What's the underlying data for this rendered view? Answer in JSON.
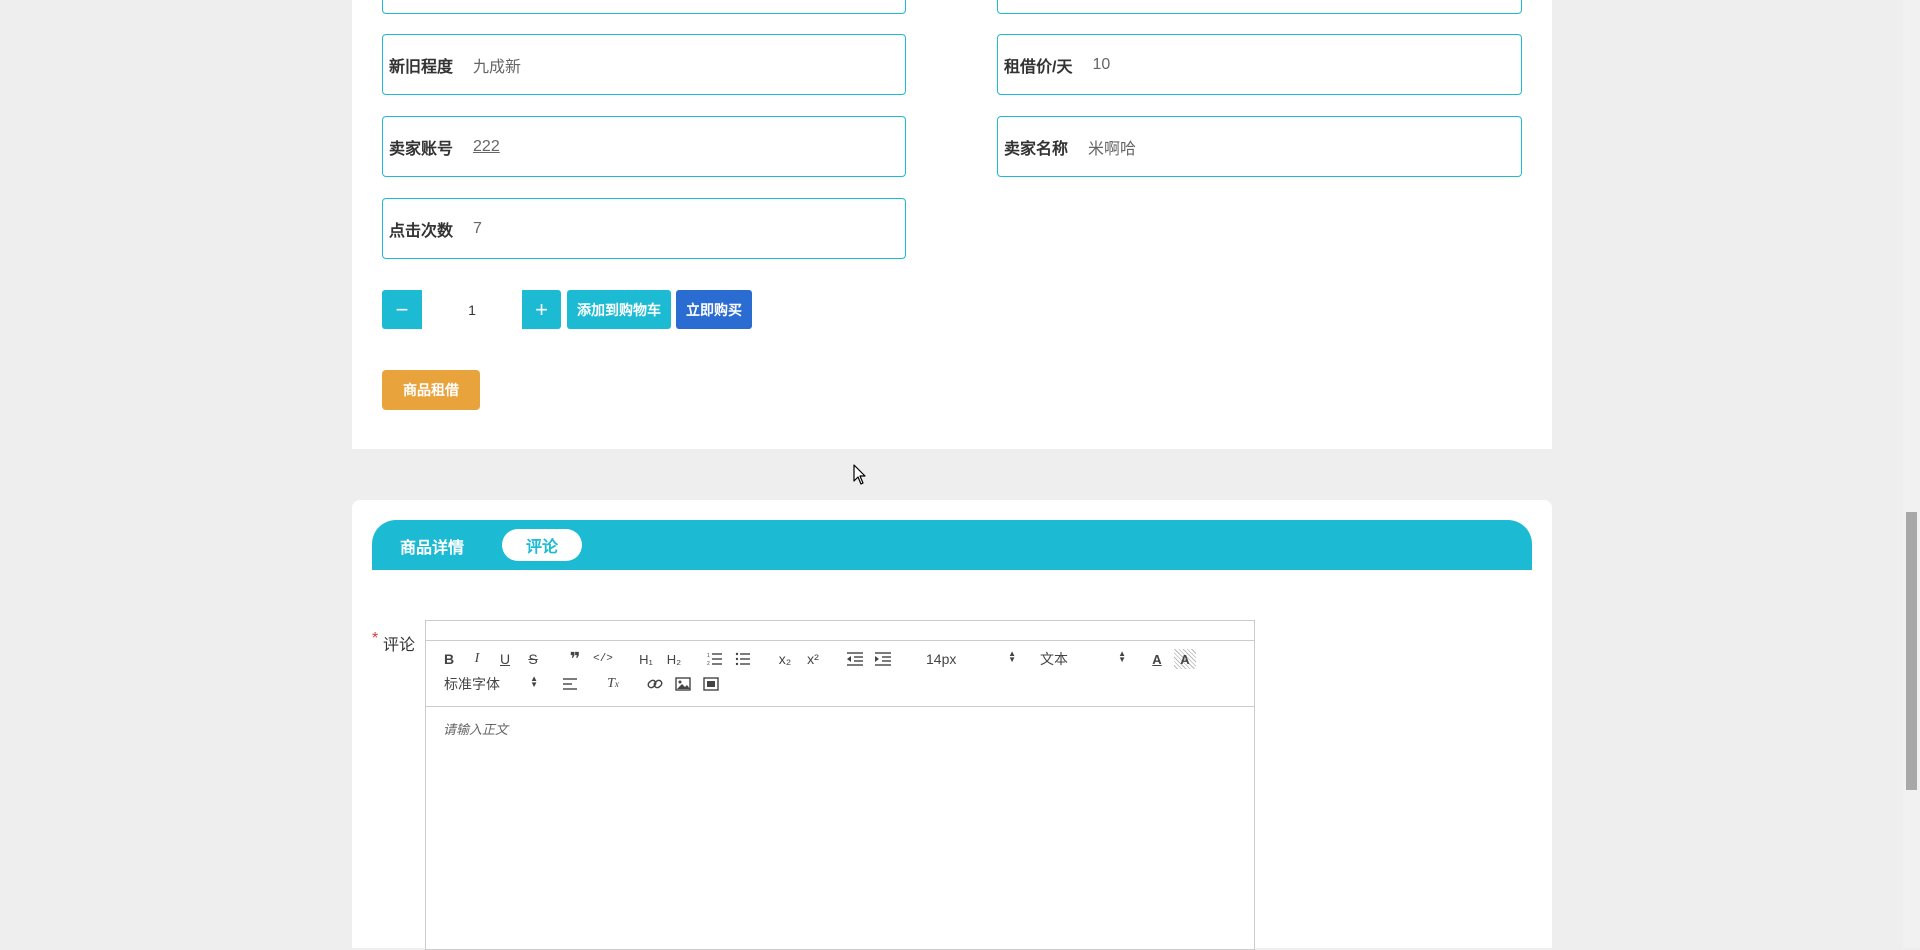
{
  "product": {
    "fields": [
      {
        "label": "新旧程度",
        "value": "九成新"
      },
      {
        "label": "租借价/天",
        "value": "10"
      },
      {
        "label": "卖家账号",
        "value": "222"
      },
      {
        "label": "卖家名称",
        "value": "米啊哈"
      },
      {
        "label": "点击次数",
        "value": "7"
      }
    ],
    "quantity": "1",
    "minus_symbol": "−",
    "plus_symbol": "+",
    "add_to_cart_label": "添加到购物车",
    "buy_now_label": "立即购买",
    "rent_label": "商品租借"
  },
  "tabs": [
    {
      "label": "商品详情",
      "active": false
    },
    {
      "label": "评论",
      "active": true
    }
  ],
  "comment": {
    "required_mark": "*",
    "label": "评论",
    "placeholder": "请输入正文"
  },
  "editor": {
    "font_size_value": "14px",
    "header_value": "文本",
    "font_family_value": "标准字体",
    "toolbar_icons": [
      "bold-icon",
      "italic-icon",
      "underline-icon",
      "strikethrough-icon",
      "blockquote-icon",
      "code-block-icon",
      "header1-icon",
      "header2-icon",
      "ordered-list-icon",
      "bullet-list-icon",
      "subscript-icon",
      "superscript-icon",
      "outdent-icon",
      "indent-icon",
      "font-color-icon",
      "background-color-icon",
      "align-icon",
      "clean-format-icon",
      "link-icon",
      "image-icon",
      "video-icon"
    ]
  },
  "colors": {
    "accent": "#1cbbd3",
    "buy_now": "#2b6cd3",
    "rent": "#e8a33d",
    "required": "#e4393c"
  }
}
